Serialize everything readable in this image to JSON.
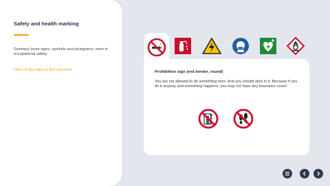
{
  "sidebar": {
    "title": "Safety and health marking",
    "intro": "Germany loves signs, symbols and pictograms, even in occupational safety.",
    "hint": "Click on the signs to find out more."
  },
  "tabs": [
    {
      "icon": "prohibition-sign-icon",
      "label": "Prohibition sign",
      "active": true
    },
    {
      "icon": "fire-extinguisher-sign-icon",
      "label": "Fire protection sign",
      "active": false
    },
    {
      "icon": "high-voltage-warning-icon",
      "label": "Warning sign",
      "active": false
    },
    {
      "icon": "face-mask-mandatory-icon",
      "label": "Mandatory sign",
      "active": false
    },
    {
      "icon": "defibrillator-sign-icon",
      "label": "Rescue sign",
      "active": false
    },
    {
      "icon": "flammable-hazard-icon",
      "label": "Hazard pictogram",
      "active": false
    }
  ],
  "content": {
    "heading": "Prohibition sign (red border, round)",
    "body": "You are not allowed to do something here. And you should stick to it. Because if you do it anyway and something happens, you may not have any insurance cover!",
    "examples": [
      {
        "icon": "no-unauthorised-access-sign-icon"
      },
      {
        "icon": "no-entry-footprints-sign-icon"
      }
    ]
  },
  "colors": {
    "accent": "#f39a17",
    "prohibition_red": "#c8102e",
    "warning_yellow": "#f7c600",
    "mandatory_blue": "#1f5f9e",
    "rescue_green": "#1f8a3b",
    "nav_dark": "#2d3a4f"
  },
  "nav": {
    "menu_icon": "menu-icon",
    "prev_icon": "chevron-left-icon",
    "next_icon": "chevron-right-icon"
  }
}
